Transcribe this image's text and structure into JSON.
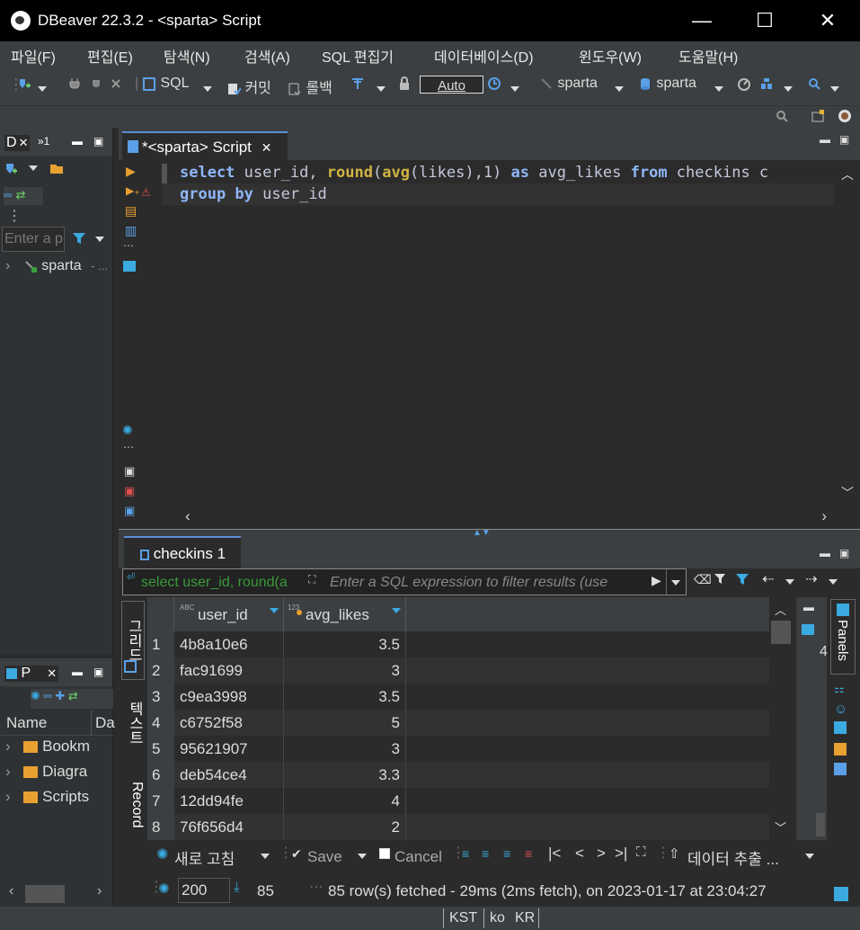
{
  "window": {
    "title": "DBeaver 22.3.2 - <sparta> Script",
    "minimize": "—",
    "maximize": "☐",
    "close": "✕"
  },
  "menu": [
    "파일(F)",
    "편집(E)",
    "탐색(N)",
    "검색(A)",
    "SQL 편집기",
    "데이터베이스(D)",
    "윈도우(W)",
    "도움말(H)"
  ],
  "toolbar": {
    "sql": "SQL",
    "commit": "커밋",
    "rollback": "롤백",
    "auto": "Auto",
    "datasource": "sparta",
    "schema": "sparta"
  },
  "navigator": {
    "tab_label": "D",
    "overflow": "»1",
    "filter_placeholder": "Enter a p",
    "tree_item": "sparta",
    "tree_item_suffix": "- ..."
  },
  "projects": {
    "tab_label": "P",
    "col_name": "Name",
    "col_da": "Da",
    "items": [
      "Bookm",
      "Diagra",
      "Scripts"
    ]
  },
  "editor": {
    "tab_label": "*<sparta> Script",
    "line1": {
      "select": "select",
      "t1": " user_id, ",
      "round": "round",
      "p1": "(",
      "avg": "avg",
      "t2": "(likes),1) ",
      "as": "as",
      "t3": " avg_likes ",
      "from": "from",
      "t4": " checkins c"
    },
    "line2": {
      "group": "group",
      "by": " by",
      "t1": " user_id"
    }
  },
  "results": {
    "tab_label": "checkins 1",
    "filter_history": "select user_id, round(a",
    "filter_placeholder": "Enter a SQL expression to filter results (use",
    "columns": [
      "user_id",
      "avg_likes"
    ],
    "rows": [
      {
        "n": "1",
        "user_id": "4b8a10e6",
        "avg_likes": "3.5"
      },
      {
        "n": "2",
        "user_id": "fac91699",
        "avg_likes": "3"
      },
      {
        "n": "3",
        "user_id": "c9ea3998",
        "avg_likes": "3.5"
      },
      {
        "n": "4",
        "user_id": "c6752f58",
        "avg_likes": "5"
      },
      {
        "n": "5",
        "user_id": "95621907",
        "avg_likes": "3"
      },
      {
        "n": "6",
        "user_id": "deb54ce4",
        "avg_likes": "3.3"
      },
      {
        "n": "7",
        "user_id": "12dd94fe",
        "avg_likes": "4"
      },
      {
        "n": "8",
        "user_id": "76f656d4",
        "avg_likes": "2"
      }
    ],
    "vtab_grid": "그리드",
    "vtab_text": "텍스트",
    "vtab_record": "Record",
    "panels_label": "Panels",
    "panel_value": "4",
    "refresh": "새로 고침",
    "save": "Save",
    "cancel": "Cancel",
    "export": "데이터 추출 ...",
    "fetch_size": "200",
    "row_count": "85",
    "status": "85 row(s) fetched - 29ms (2ms fetch), on 2023-01-17 at 23:04:27"
  },
  "statusbar": {
    "tz": "KST",
    "lang": "ko",
    "region": "KR"
  }
}
